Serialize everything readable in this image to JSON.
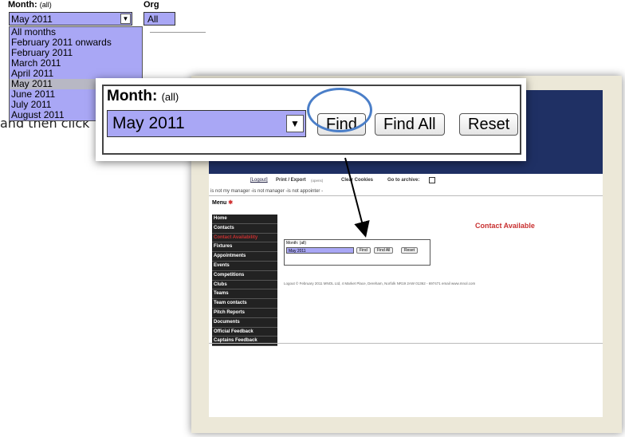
{
  "snippet": {
    "month_label": "Month:",
    "month_qualifier": "(all)",
    "org_label": "Org",
    "selected_month": "May 2011",
    "second_select_value": "All",
    "options": [
      "All months",
      "February 2011 onwards",
      "February 2011",
      "March 2011",
      "April 2011",
      "May 2011",
      "June 2011",
      "July 2011",
      "August 2011"
    ],
    "highlighted_option": "May 2011"
  },
  "side_text": "and then click",
  "zoom": {
    "month_label": "Month:",
    "month_qualifier": "(all)",
    "selected_month": "May 2011",
    "find_label": "Find",
    "find_all_label": "Find All",
    "reset_label": "Reset"
  },
  "page": {
    "toolbar": {
      "logout": "[Logout]",
      "print_export": "Print / Export",
      "print_export_note": "(opens)",
      "clear_cookies": "Clear Cookies",
      "go_to_archive": "Go to archive:"
    },
    "crumb": "is not my manager -is not manager -is not appointer -",
    "menu_title": "Menu",
    "menu_items": [
      "Home",
      "Contacts",
      "Contact Availability",
      "Fixtures",
      "Appointments",
      "Events",
      "Competitions",
      "Clubs",
      "Teams",
      "Team contacts",
      "Pitch Reports",
      "Documents",
      "Official Feedback",
      "Captains Feedback"
    ],
    "contact_heading": "Contact Available",
    "mini_form": {
      "month_label": "Month: (all)",
      "selected": "May 2011",
      "find": "Find",
      "find_all": "Find All",
      "reset": "Reset"
    },
    "footer": "Logout © February 2011  MNOL Ltd, 4 Market Place, Dereham, Norfolk NR19 2AW  01362 - 697471 email  www.mnol.com"
  },
  "colors": {
    "select_bg": "#a9a7f5",
    "banner": "#1f3064",
    "heading_red": "#c83030",
    "circle_blue": "#4a7ec8"
  }
}
